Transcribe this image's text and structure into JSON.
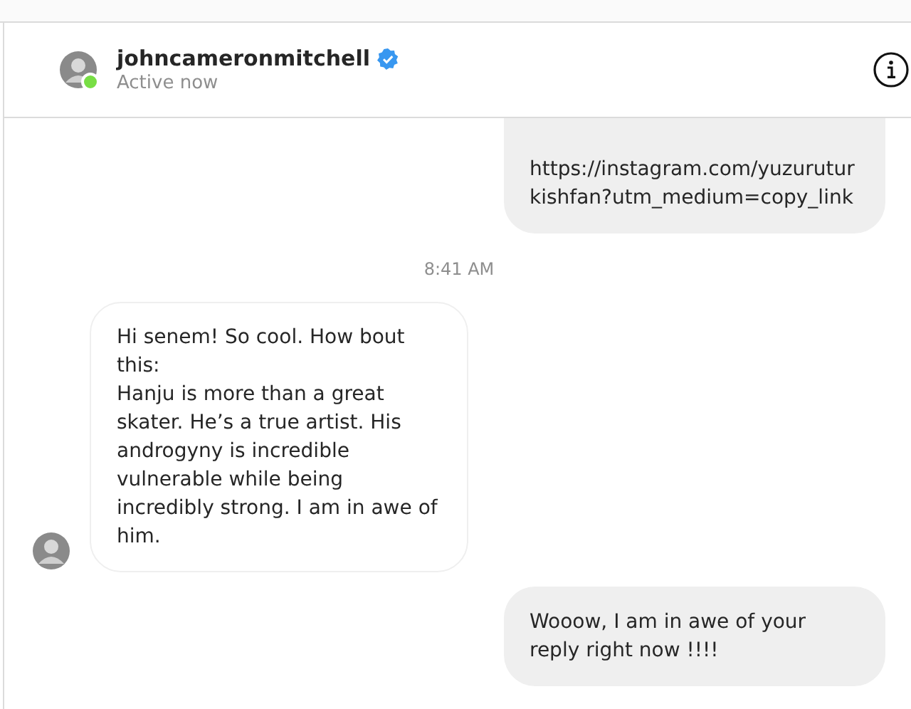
{
  "header": {
    "username": "johncameronmitchell",
    "verified": true,
    "online": true,
    "status": "Active now"
  },
  "messages": [
    {
      "kind": "outgoing",
      "text": "https://instagram.com/yuzurutur\nkishfan?utm_medium=copy_link",
      "clipped_top": true
    },
    {
      "kind": "timestamp",
      "text": "8:41 AM"
    },
    {
      "kind": "incoming",
      "text": "Hi senem! So cool. How bout this:\nHanju is more than a great skater. He’s a true artist. His androgyny is incredible vulnerable while being incredibly strong. I am in awe of him.",
      "avatar": true
    },
    {
      "kind": "outgoing",
      "text": "Wooow, I am in awe of your reply right now !!!!",
      "clipped_top": false
    }
  ]
}
